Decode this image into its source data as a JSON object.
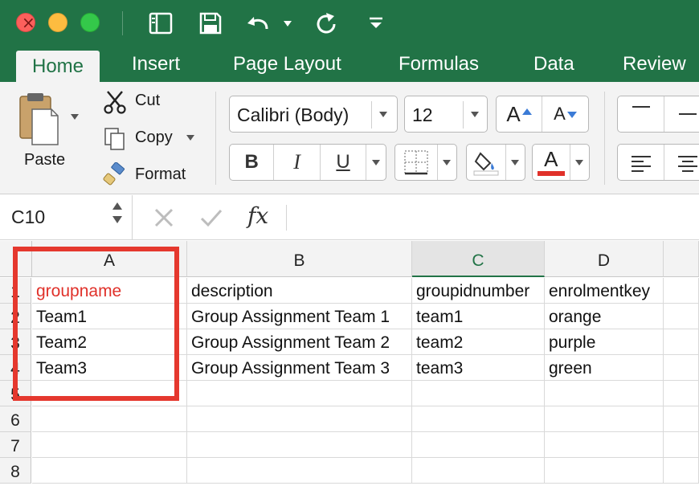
{
  "window": {
    "quick_access_icons": [
      "sidebar-icon",
      "save-icon",
      "undo-icon",
      "redo-icon",
      "customize-icon"
    ]
  },
  "tabs": [
    {
      "label": "Home",
      "active": true
    },
    {
      "label": "Insert"
    },
    {
      "label": "Page Layout"
    },
    {
      "label": "Formulas"
    },
    {
      "label": "Data"
    },
    {
      "label": "Review"
    }
  ],
  "ribbon": {
    "paste_label": "Paste",
    "cut_label": "Cut",
    "copy_label": "Copy",
    "format_label": "Format",
    "font_name": "Calibri (Body)",
    "font_size": "12",
    "bold": "B",
    "italic": "I",
    "underline": "U",
    "font_color": "#e0312a"
  },
  "formula_bar": {
    "name_box": "C10",
    "fx": "fx",
    "value": ""
  },
  "sheet": {
    "selected_column": "C",
    "columns": [
      "A",
      "B",
      "C",
      "D"
    ],
    "row_numbers": [
      "1",
      "2",
      "3",
      "4",
      "5",
      "6",
      "7",
      "8"
    ],
    "rows": [
      [
        "groupname",
        "description",
        "groupidnumber",
        "enrolmentkey"
      ],
      [
        "Team1",
        "Group Assignment Team 1",
        "team1",
        "orange"
      ],
      [
        "Team2",
        "Group Assignment Team 2",
        "team2",
        "purple"
      ],
      [
        "Team3",
        "Group Assignment Team 3",
        "team3",
        "green"
      ],
      [
        "",
        "",
        "",
        ""
      ],
      [
        "",
        "",
        "",
        ""
      ],
      [
        "",
        "",
        "",
        ""
      ],
      [
        "",
        "",
        "",
        ""
      ]
    ],
    "highlight_color": "#e5382e",
    "header_text_color": "#e0312a"
  }
}
